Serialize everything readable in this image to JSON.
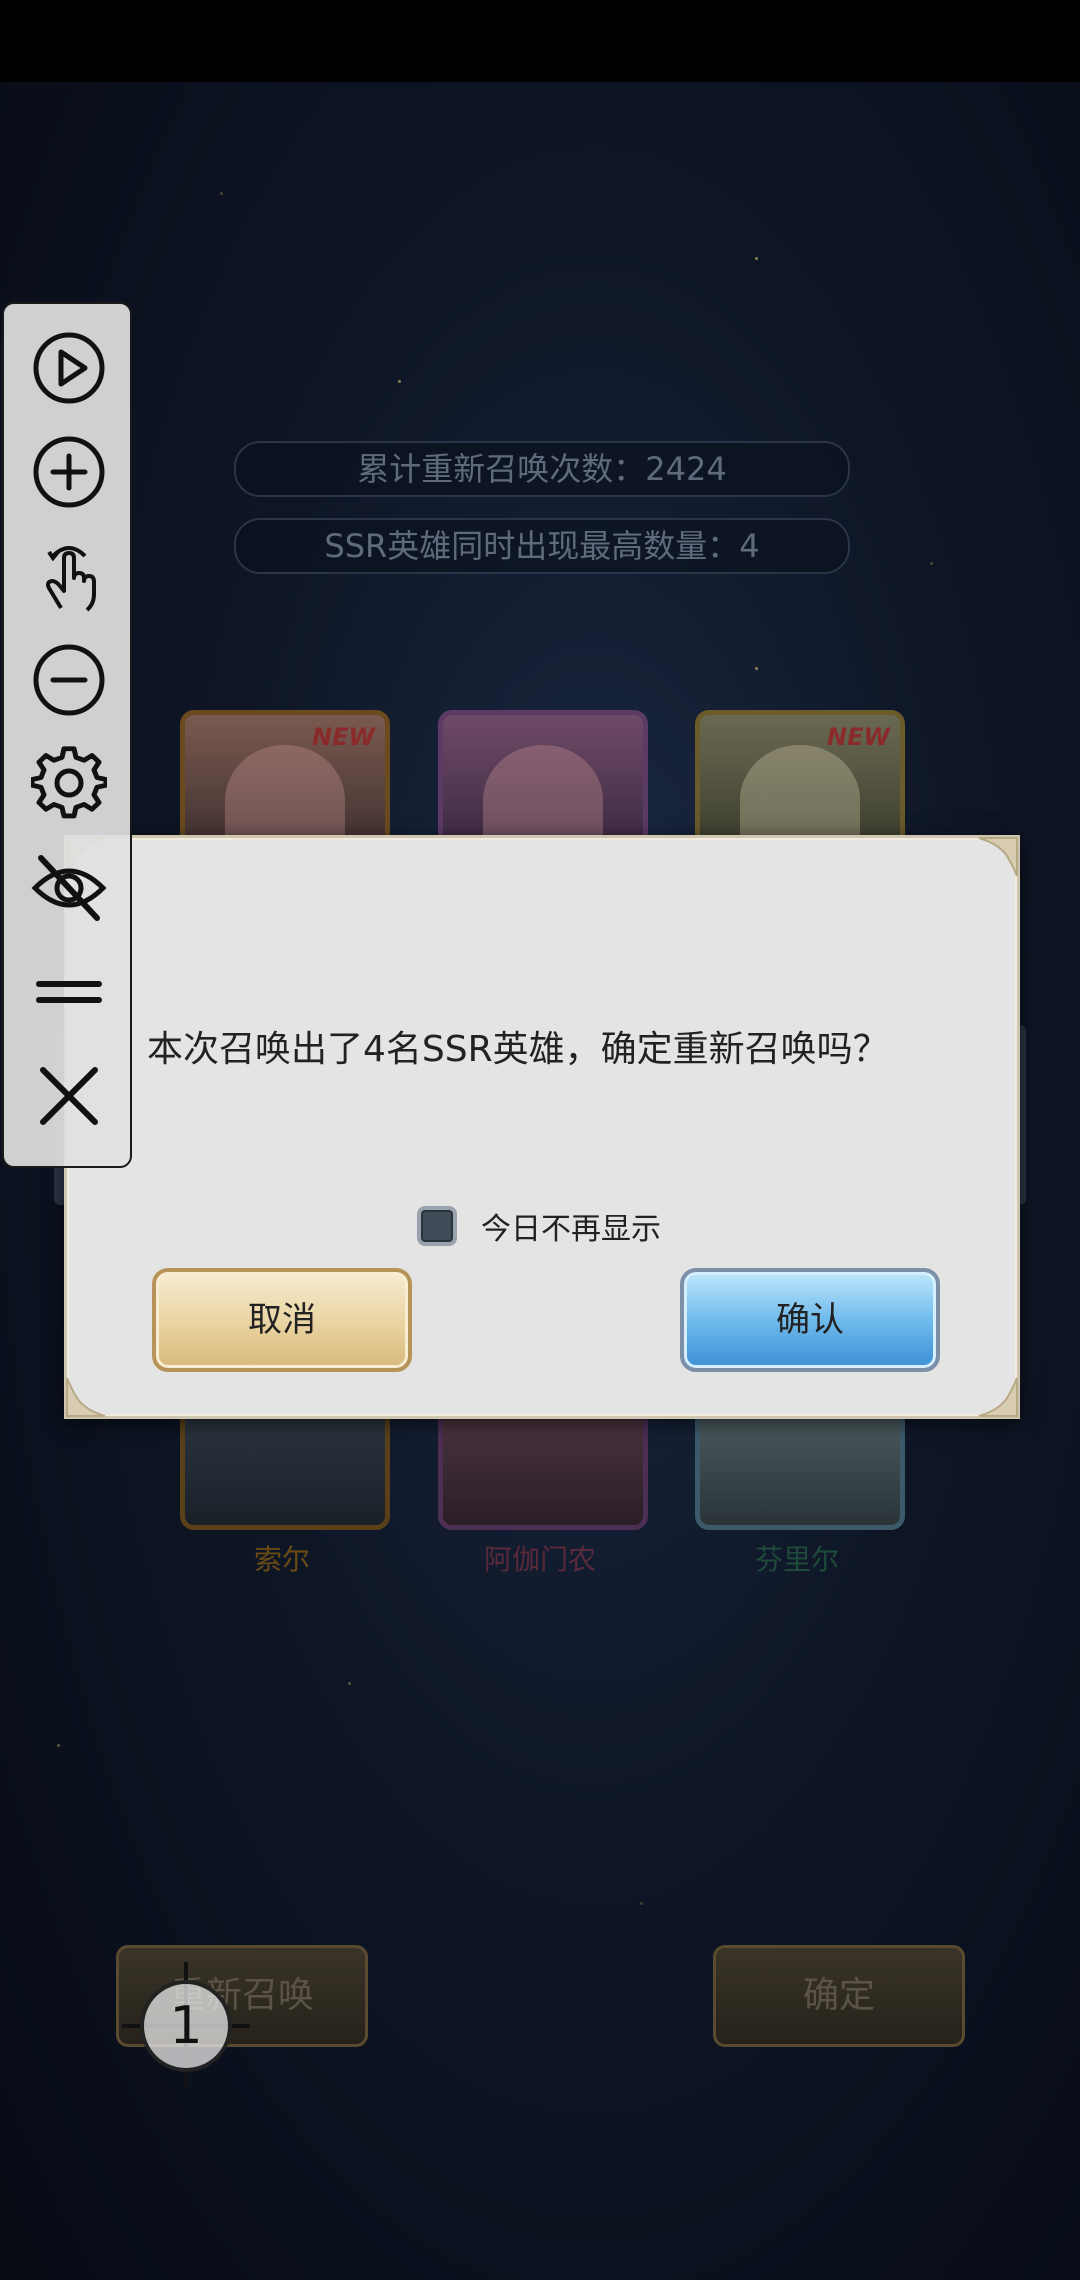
{
  "stats": {
    "total_resummon": "累计重新召唤次数：2424",
    "max_ssr": "SSR英雄同时出现最高数量：4"
  },
  "heroes": {
    "new_tag": "NEW",
    "names": [
      "索尔",
      "阿伽门农",
      "芬里尔"
    ],
    "name_colors": [
      "#6a4a14",
      "#5a2a3a",
      "#1e4a3a"
    ]
  },
  "bottom_buttons": {
    "resummon": "重新召唤",
    "confirm": "确定"
  },
  "dialog": {
    "message": "本次召唤出了4名SSR英雄，确定重新召唤吗？",
    "checkbox_label": "今日不再显示",
    "cancel": "取消",
    "confirm": "确认"
  },
  "toolbar": {
    "icons": [
      "play-icon",
      "zoom-in-icon",
      "tap-gesture-icon",
      "zoom-out-icon",
      "gear-icon",
      "eye-off-icon",
      "drag-handle-icon",
      "close-icon"
    ]
  },
  "touch_marker": {
    "label": "1"
  },
  "colors": {
    "dialog_bg": "#e4e4e4",
    "cancel_button": "#e9d3a0",
    "confirm_button": "#6fbbec",
    "toolbar_bg": "#e1e1e1"
  }
}
